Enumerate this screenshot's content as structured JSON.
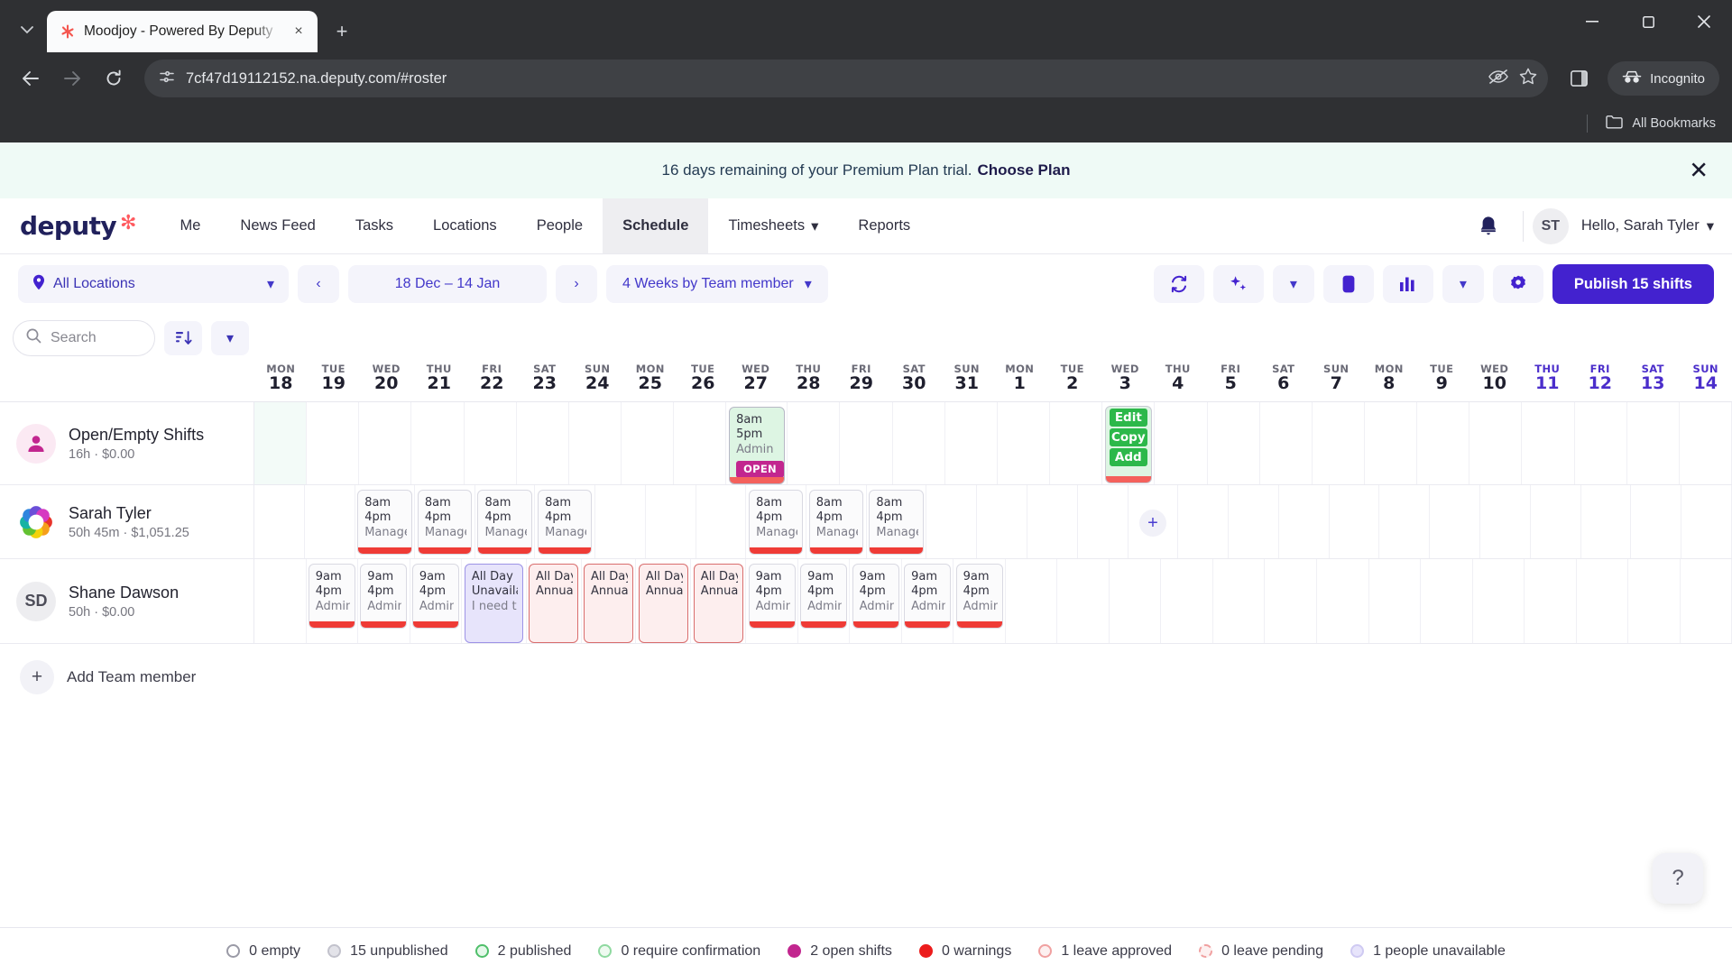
{
  "browser": {
    "tab_title": "Moodjoy - Powered By Deputy",
    "url": "7cf47d19112152.na.deputy.com/#roster",
    "incognito_label": "Incognito",
    "bookmarks_label": "All Bookmarks",
    "new_tab_glyph": "+",
    "tab_close_glyph": "×",
    "back_glyph": "←",
    "forward_glyph": "→",
    "reload_glyph": "⟳",
    "minimize_glyph": "—",
    "maximize_glyph": "☐",
    "close_glyph": "✕",
    "tablist_glyph": "⌄"
  },
  "trial": {
    "message": "16 days remaining of your Premium Plan trial.",
    "cta": "Choose Plan",
    "close_glyph": "✕"
  },
  "nav": {
    "logo_text": "deputy",
    "logo_star": "✻",
    "items": [
      {
        "label": "Me",
        "active": false,
        "caret": false
      },
      {
        "label": "News Feed",
        "active": false,
        "caret": false
      },
      {
        "label": "Tasks",
        "active": false,
        "caret": false
      },
      {
        "label": "Locations",
        "active": false,
        "caret": false
      },
      {
        "label": "People",
        "active": false,
        "caret": false
      },
      {
        "label": "Schedule",
        "active": true,
        "caret": false
      },
      {
        "label": "Timesheets",
        "active": false,
        "caret": true
      },
      {
        "label": "Reports",
        "active": false,
        "caret": false
      }
    ],
    "bell_glyph": "🔔",
    "avatar_initials": "ST",
    "greeting": "Hello, Sarah Tyler",
    "caret_glyph": "▾"
  },
  "toolbar": {
    "location_label": "All Locations",
    "prev_glyph": "‹",
    "date_range": "18 Dec – 14 Jan",
    "next_glyph": "›",
    "view_label": "4 Weeks by Team member",
    "caret_glyph": "▾",
    "refresh_icon": "refresh-icon",
    "magic_icon": "auto-schedule-icon",
    "stop_icon": "stop-icon",
    "stats_icon": "insights-icon",
    "gear_icon": "settings-icon",
    "publish_label": "Publish 15 shifts"
  },
  "search": {
    "placeholder": "Search",
    "sort_icon": "sort-icon",
    "filter_caret": "▾"
  },
  "days": [
    {
      "dow": "MON",
      "num": "18",
      "highlight": false
    },
    {
      "dow": "TUE",
      "num": "19",
      "highlight": false
    },
    {
      "dow": "WED",
      "num": "20",
      "highlight": false
    },
    {
      "dow": "THU",
      "num": "21",
      "highlight": false
    },
    {
      "dow": "FRI",
      "num": "22",
      "highlight": false
    },
    {
      "dow": "SAT",
      "num": "23",
      "highlight": false
    },
    {
      "dow": "SUN",
      "num": "24",
      "highlight": false
    },
    {
      "dow": "MON",
      "num": "25",
      "highlight": false
    },
    {
      "dow": "TUE",
      "num": "26",
      "highlight": false
    },
    {
      "dow": "WED",
      "num": "27",
      "highlight": false
    },
    {
      "dow": "THU",
      "num": "28",
      "highlight": false
    },
    {
      "dow": "FRI",
      "num": "29",
      "highlight": false
    },
    {
      "dow": "SAT",
      "num": "30",
      "highlight": false
    },
    {
      "dow": "SUN",
      "num": "31",
      "highlight": false
    },
    {
      "dow": "MON",
      "num": "1",
      "highlight": false
    },
    {
      "dow": "TUE",
      "num": "2",
      "highlight": false
    },
    {
      "dow": "WED",
      "num": "3",
      "highlight": false
    },
    {
      "dow": "THU",
      "num": "4",
      "highlight": false
    },
    {
      "dow": "FRI",
      "num": "5",
      "highlight": false
    },
    {
      "dow": "SAT",
      "num": "6",
      "highlight": false
    },
    {
      "dow": "SUN",
      "num": "7",
      "highlight": false
    },
    {
      "dow": "MON",
      "num": "8",
      "highlight": false
    },
    {
      "dow": "TUE",
      "num": "9",
      "highlight": false
    },
    {
      "dow": "WED",
      "num": "10",
      "highlight": false
    },
    {
      "dow": "THU",
      "num": "11",
      "highlight": true
    },
    {
      "dow": "FRI",
      "num": "12",
      "highlight": true
    },
    {
      "dow": "SAT",
      "num": "13",
      "highlight": true
    },
    {
      "dow": "SUN",
      "num": "14",
      "highlight": true
    }
  ],
  "rows": [
    {
      "name": "Open/Empty Shifts",
      "sub": "16h · $0.00",
      "avatar_type": "open",
      "avatar_text": "",
      "tint_cells": [
        0
      ],
      "cards": [
        {
          "col": 9,
          "type": "open",
          "lines": [
            "8am",
            "5pm",
            "Admin"
          ],
          "badge": "OPEN"
        },
        {
          "col": 16,
          "type": "ctxmenu",
          "lines": [],
          "menu": [
            "Edit",
            "Copy",
            "Add"
          ]
        }
      ]
    },
    {
      "name": "Sarah Tyler",
      "sub": "50h 45m · $1,051.25",
      "avatar_type": "flower",
      "avatar_text": "",
      "tint_cells": [],
      "cards": [
        {
          "col": 2,
          "type": "shift",
          "lines": [
            "8am",
            "4pm",
            "Manage"
          ]
        },
        {
          "col": 3,
          "type": "shift",
          "lines": [
            "8am",
            "4pm",
            "Manage"
          ]
        },
        {
          "col": 4,
          "type": "shift",
          "lines": [
            "8am",
            "4pm",
            "Manage"
          ]
        },
        {
          "col": 5,
          "type": "shift",
          "lines": [
            "8am",
            "4pm",
            "Manage"
          ]
        },
        {
          "col": 9,
          "type": "shift",
          "lines": [
            "8am",
            "4pm",
            "Manage"
          ]
        },
        {
          "col": 10,
          "type": "shift",
          "lines": [
            "8am",
            "4pm",
            "Manage"
          ]
        },
        {
          "col": 11,
          "type": "shift",
          "lines": [
            "8am",
            "4pm",
            "Manage"
          ]
        },
        {
          "col": 16,
          "type": "plus",
          "lines": []
        }
      ]
    },
    {
      "name": "Shane Dawson",
      "sub": "50h · $0.00",
      "avatar_type": "initials",
      "avatar_text": "SD",
      "tint_cells": [],
      "cards": [
        {
          "col": 1,
          "type": "shift",
          "lines": [
            "9am",
            "4pm",
            "Admin"
          ]
        },
        {
          "col": 2,
          "type": "shift",
          "lines": [
            "9am",
            "4pm",
            "Admin"
          ]
        },
        {
          "col": 3,
          "type": "shift",
          "lines": [
            "9am",
            "4pm",
            "Admin"
          ]
        },
        {
          "col": 4,
          "type": "unavail",
          "lines": [
            "All Day",
            "Unavaila",
            "I need t"
          ]
        },
        {
          "col": 5,
          "type": "leave",
          "lines": [
            "All Day",
            "Annual"
          ]
        },
        {
          "col": 6,
          "type": "leave",
          "lines": [
            "All Day",
            "Annual"
          ]
        },
        {
          "col": 7,
          "type": "leave",
          "lines": [
            "All Day",
            "Annual"
          ]
        },
        {
          "col": 8,
          "type": "leave",
          "lines": [
            "All Day",
            "Annual"
          ]
        },
        {
          "col": 9,
          "type": "shift",
          "lines": [
            "9am",
            "4pm",
            "Admin"
          ]
        },
        {
          "col": 10,
          "type": "shift",
          "lines": [
            "9am",
            "4pm",
            "Admin"
          ]
        },
        {
          "col": 11,
          "type": "shift",
          "lines": [
            "9am",
            "4pm",
            "Admin"
          ]
        },
        {
          "col": 12,
          "type": "shift",
          "lines": [
            "9am",
            "4pm",
            "Admin"
          ]
        },
        {
          "col": 13,
          "type": "shift",
          "lines": [
            "9am",
            "4pm",
            "Admin"
          ]
        }
      ]
    }
  ],
  "add_member": {
    "label": "Add Team member",
    "plus_glyph": "+"
  },
  "status": [
    {
      "label": "0 empty",
      "color": "#ffffff",
      "border": "#9a9aa6",
      "style": "solid"
    },
    {
      "label": "15 unpublished",
      "color": "#e3e3e9",
      "border": "#c2c2cc",
      "style": "solid"
    },
    {
      "label": "2 published",
      "color": "#e5f8ea",
      "border": "#4fbf6a",
      "style": "solid"
    },
    {
      "label": "0 require confirmation",
      "color": "#eefaf0",
      "border": "#8fd9a0",
      "style": "solid"
    },
    {
      "label": "2 open shifts",
      "color": "#c2268f",
      "border": "#c2268f",
      "style": "solid"
    },
    {
      "label": "0 warnings",
      "color": "#ec1c1c",
      "border": "#ec1c1c",
      "style": "solid"
    },
    {
      "label": "1 leave approved",
      "color": "#fdf0f0",
      "border": "#f0a0a0",
      "style": "solid"
    },
    {
      "label": "0 leave pending",
      "color": "#fdf0f0",
      "border": "#f0a0a0",
      "style": "dashed"
    },
    {
      "label": "1 people unavailable",
      "color": "#e7e4fb",
      "border": "#cfcaf2",
      "style": "solid"
    }
  ],
  "help": {
    "glyph": "?"
  }
}
